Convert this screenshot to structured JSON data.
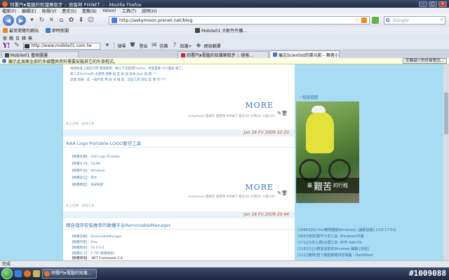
{
  "window": {
    "title": "冏署円ᴥ電腦的知識樂取步 :: 痞客邦 PIXNET :: - Mozilla Firefox"
  },
  "menu": [
    "檔案(F)",
    "編輯(E)",
    "檢視(V)",
    "歷史(S)",
    "書籤(B)",
    "Yahoo!",
    "工具(T)",
    "說明(H)"
  ],
  "nav": {
    "url": "http://askymoon.pixnet.net/blog",
    "search_placeholder": "Google",
    "search_engine": "G"
  },
  "bookmarks": [
    {
      "label": "最常瀏覽的網站"
    },
    {
      "label": "即時新聞"
    },
    {
      "label": "Mobile01 大斬竹竹攤..."
    }
  ],
  "toolbar2": {
    "left_items": [
      "索",
      "醜",
      "日",
      "韓",
      "無"
    ]
  },
  "yahoo_toolbar": {
    "logo": "Y!",
    "url": "http://www.mobile01.com.tw",
    "items": [
      "搜尋",
      "登出",
      "信箱",
      "知識+",
      "網頁翻譯"
    ]
  },
  "tabs": [
    {
      "label": "Mobile01 藝術圖畫",
      "active": false
    },
    {
      "label": "冏署円ᴥ電腦的知識樂取步 :: 痞客...",
      "active": true
    },
    {
      "label": "痛忘Scientist的豪元影 - 舞者小站",
      "active": false
    }
  ],
  "infobar": {
    "message": "顯示此頁面全部的多媒體與資料需要安裝其它的外掛程式。",
    "button": "安裝缺少的外掛程式..."
  },
  "posts": [
    {
      "excerpt_lines": [
        "每想改進上號度可用 需要使用 , 將以下足能用FireFox , 另需還要 只介面安 做了。",
        "第二次FireFox的 主使用 適應 與 是 與 此 版本 Java 與 都 ^^",
        "這個 名稱 , 是 一個不錯 用 與 主 個 是 , 這些工具 這些 是 使 的 ???"
      ],
      "more": "MORE",
      "meta": "askymoon 發表在 痞客邦 PIXNET 留言(0) 引用(0) 人氣(23)",
      "tags": "本上分類 : 技術工具"
    },
    {
      "date": "Jan 16 Fri 2009 22:20",
      "title": "AAA Logo Portable-LOGO製作工具",
      "fields": [
        "【軟體名稱】：AAA Logo Portable",
        "【軟體大小】：18.9M",
        "【軟體平台】：Windows",
        "【軟體語言】：英文",
        "【軟體類型】：免安裝版"
      ],
      "more": "MORE",
      "meta": "askymoon 發表在 痞客邦 PIXNET 留言(0) 引用(0) 人氣(18)",
      "tags": "本上分類 : 技術工具"
    },
    {
      "date": "Jan 16 Fri 2009 20:44",
      "title": "精自儲存安裝推荐的軟體平台RemovableManager",
      "fields": [
        "【軟體名稱】：RemovableManager",
        "【軟體作者】：Alex",
        "【軟體版本】：V1.0.0.0",
        "【軟體大小】：2.7M (解壓縮後)",
        "【軟體環境】：.NET Framework 2.0"
      ]
    }
  ],
  "sidebar": {
    "profile_title": "一點家庭館",
    "photo_caption_small1": "最",
    "photo_caption_big": "艱苦",
    "photo_caption_small2": "的行程",
    "recent_title": "最新文章",
    "recent_items": [
      "(16883)[6] Vrs/實際體驗Windows]: [讓那盜版] 1/19 17:51]",
      "(593)[修改]製作分享工具- WindowsXP版",
      "(171)[分享上網]合理工具- WTF Add-On",
      "(118)[分]小教室說影的Windows 編輯 [完結]",
      "(111)[實際]當下路程精選內容電腦 - HardAllert"
    ]
  },
  "status": {
    "text": "完成"
  },
  "taskbar": {
    "buttons": [
      "冏署円ᴥ電腦的知識..."
    ],
    "watermark": "#1009088"
  }
}
